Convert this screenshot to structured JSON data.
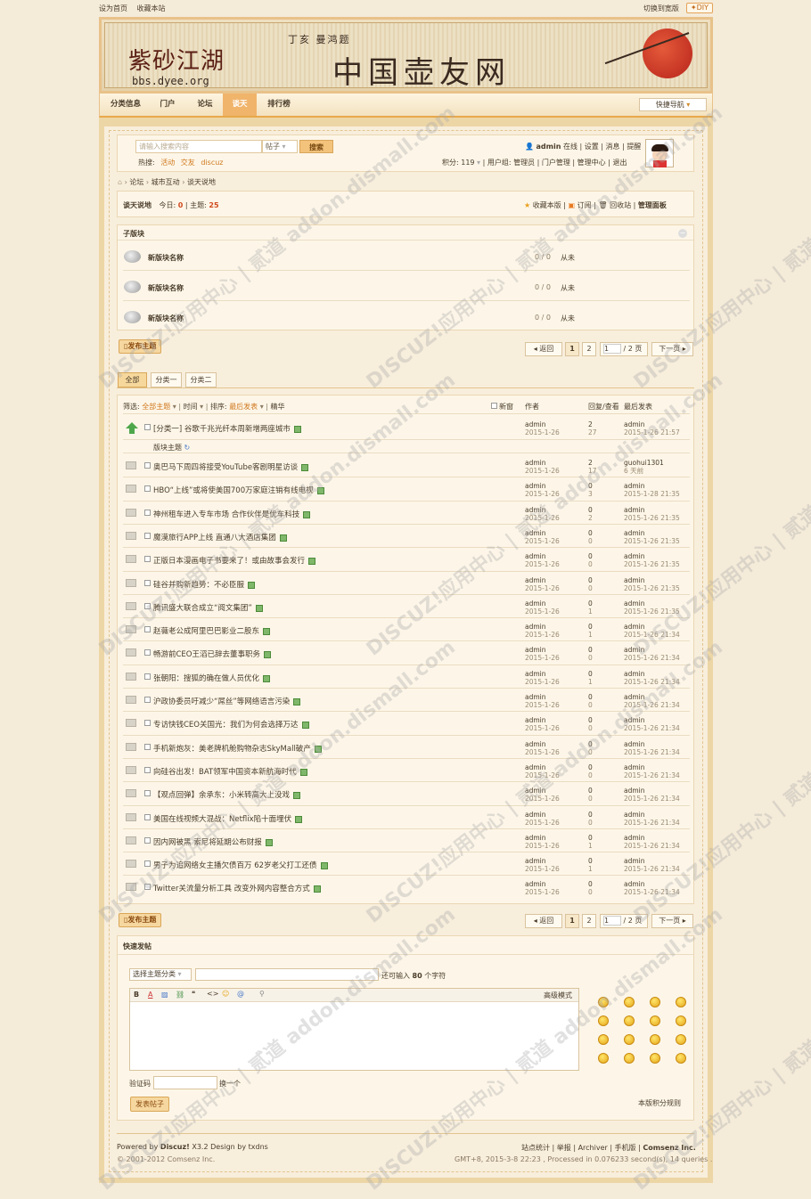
{
  "topbar": {
    "set_home": "设为首页",
    "bookmark": "收藏本站",
    "switch_width": "切换到宽版",
    "diy": "✦DIY"
  },
  "banner": {
    "logo_cn": "紫砂江湖",
    "logo_url": "bbs.dyee.org",
    "site_name": "中国壶友网",
    "slogan": "丁亥 曼鸿题"
  },
  "nav": {
    "items": [
      "分类信息",
      "门户",
      "论坛",
      "谈天",
      "排行榜"
    ],
    "active": "谈天",
    "quick_nav": "快捷导航"
  },
  "search": {
    "placeholder": "请输入搜索内容",
    "type": "帖子",
    "button": "搜索",
    "hot_label": "热搜:",
    "hot": [
      "活动",
      "交友",
      "discuz"
    ]
  },
  "user": {
    "name": "admin",
    "online": "在线",
    "links": [
      "设置",
      "消息",
      "提醒"
    ],
    "points_label": "积分: 119",
    "group_label": "用户组:",
    "group": "管理员",
    "admin_links": [
      "门户管理",
      "管理中心",
      "退出"
    ]
  },
  "breadcrumb": [
    "论坛",
    "城市互动",
    "谈天说地"
  ],
  "forum": {
    "name": "谈天说地",
    "today_label": "今日:",
    "today": "0",
    "topics_label": "主题:",
    "topics": "25",
    "actions": [
      "收藏本版",
      "订阅",
      "回收站",
      "管理面板"
    ]
  },
  "subforums": {
    "title": "子版块",
    "rows": [
      {
        "name": "新版块名称",
        "stats": "0 / 0",
        "last": "从未"
      },
      {
        "name": "新版块名称",
        "stats": "0 / 0",
        "last": "从未"
      },
      {
        "name": "新版块名称",
        "stats": "0 / 0",
        "last": "从未"
      }
    ]
  },
  "pager": {
    "post_button": "发布主题",
    "back": "返回",
    "pages": [
      "1",
      "2"
    ],
    "page_input": "1",
    "total": "/ 2 页",
    "next": "下一页"
  },
  "tabs": [
    "全部",
    "分类一",
    "分类二"
  ],
  "filter": {
    "label": "筛选:",
    "all_topics": "全部主题",
    "time": "时间",
    "sort_label": "排序:",
    "sort": "最后发表",
    "digest": "精华",
    "new_window": "新窗",
    "col_author": "作者",
    "col_replies": "回复/查看",
    "col_last": "最后发表"
  },
  "pinned": {
    "title": "[分类一] 谷歌千兆光纤本周新增两座城市",
    "author": "admin",
    "date": "2015-1-26",
    "replies": "2",
    "views": "27",
    "last_user": "admin",
    "last_time": "2015-1-26 21:57"
  },
  "normal_label": "版块主题",
  "threads": [
    {
      "title": "奥巴马下周四将接受YouTube客剧明星访谈",
      "author": "admin",
      "date": "2015-1-26",
      "replies": "2",
      "views": "17",
      "last_user": "guohui1301",
      "last_time": "6 天前"
    },
    {
      "title": "HBO“上线”或将使美国700万家庭注销有线电视",
      "author": "admin",
      "date": "2015-1-26",
      "replies": "0",
      "views": "3",
      "last_user": "admin",
      "last_time": "2015-1-28 21:35"
    },
    {
      "title": "神州租车进入专车市场 合作伙伴是优车科技",
      "author": "admin",
      "date": "2015-1-26",
      "replies": "0",
      "views": "2",
      "last_user": "admin",
      "last_time": "2015-1-26 21:35"
    },
    {
      "title": "魔漠旅行APP上线 直通八大酒店集团",
      "author": "admin",
      "date": "2015-1-26",
      "replies": "0",
      "views": "0",
      "last_user": "admin",
      "last_time": "2015-1-26 21:35"
    },
    {
      "title": "正版日本漫画电子书要来了！或由故事会发行",
      "author": "admin",
      "date": "2015-1-26",
      "replies": "0",
      "views": "0",
      "last_user": "admin",
      "last_time": "2015-1-26 21:35"
    },
    {
      "title": "硅谷并购新趋势：不必臣服",
      "author": "admin",
      "date": "2015-1-26",
      "replies": "0",
      "views": "0",
      "last_user": "admin",
      "last_time": "2015-1-26 21:35"
    },
    {
      "title": "腾讯盛大联合成立“阅文集团”",
      "author": "admin",
      "date": "2015-1-26",
      "replies": "0",
      "views": "1",
      "last_user": "admin",
      "last_time": "2015-1-26 21:35"
    },
    {
      "title": "赵薇老公成阿里巴巴影业二股东",
      "author": "admin",
      "date": "2015-1-26",
      "replies": "0",
      "views": "1",
      "last_user": "admin",
      "last_time": "2015-1-26 21:34"
    },
    {
      "title": "畅游前CEO王滔已辞去董事职务",
      "author": "admin",
      "date": "2015-1-26",
      "replies": "0",
      "views": "0",
      "last_user": "admin",
      "last_time": "2015-1-26 21:34"
    },
    {
      "title": "张朝阳：搜狐的确在做人员优化",
      "author": "admin",
      "date": "2015-1-26",
      "replies": "0",
      "views": "1",
      "last_user": "admin",
      "last_time": "2015-1-26 21:34"
    },
    {
      "title": "沪政协委员吁减少“屌丝”等网络语言污染",
      "author": "admin",
      "date": "2015-1-26",
      "replies": "0",
      "views": "0",
      "last_user": "admin",
      "last_time": "2015-1-26 21:34"
    },
    {
      "title": "专访快钱CEO关国光：我们为何会选择万达",
      "author": "admin",
      "date": "2015-1-26",
      "replies": "0",
      "views": "0",
      "last_user": "admin",
      "last_time": "2015-1-26 21:34"
    },
    {
      "title": "手机新炮灰：美老牌机舱购物杂志SkyMall破产",
      "author": "admin",
      "date": "2015-1-26",
      "replies": "0",
      "views": "0",
      "last_user": "admin",
      "last_time": "2015-1-26 21:34"
    },
    {
      "title": "向硅谷出发！BAT领军中国资本新航海时代",
      "author": "admin",
      "date": "2015-1-26",
      "replies": "0",
      "views": "0",
      "last_user": "admin",
      "last_time": "2015-1-26 21:34"
    },
    {
      "title": "【观点回弹】余承东：小米转高大上没戏",
      "author": "admin",
      "date": "2015-1-26",
      "replies": "0",
      "views": "0",
      "last_user": "admin",
      "last_time": "2015-1-26 21:34"
    },
    {
      "title": "美国在线视频大混战：Netflix陷十面埋伏",
      "author": "admin",
      "date": "2015-1-26",
      "replies": "0",
      "views": "0",
      "last_user": "admin",
      "last_time": "2015-1-26 21:34"
    },
    {
      "title": "因内网被黑 索尼将延期公布财报",
      "author": "admin",
      "date": "2015-1-26",
      "replies": "0",
      "views": "1",
      "last_user": "admin",
      "last_time": "2015-1-26 21:34"
    },
    {
      "title": "男子为追网络女主播欠债百万 62岁老父打工还债",
      "author": "admin",
      "date": "2015-1-26",
      "replies": "0",
      "views": "1",
      "last_user": "admin",
      "last_time": "2015-1-26 21:34"
    },
    {
      "title": "Twitter关流量分析工具 改变外网内容整合方式",
      "author": "admin",
      "date": "2015-1-26",
      "replies": "0",
      "views": "0",
      "last_user": "admin",
      "last_time": "2015-1-26 21:34"
    }
  ],
  "quickpost": {
    "title": "快速发帖",
    "select_type": "选择主题分类",
    "remain_prefix": "还可输入",
    "remain": "80",
    "remain_suffix": "个字符",
    "advanced": "高级模式",
    "captcha_label": "验证码",
    "captcha_refresh": "换一个",
    "submit": "发表帖子",
    "rules": "本版积分规则"
  },
  "footer": {
    "powered_prefix": "Powered by",
    "powered_brand": "Discuz!",
    "powered_suffix": "X3.2 Design by txdns",
    "copyright": "© 2001-2012 Comsenz Inc.",
    "links": [
      "站点统计",
      "举报",
      "Archiver",
      "手机版"
    ],
    "company": "Comsenz Inc.",
    "runtime": "GMT+8, 2015-3-8 22:23 , Processed in 0.076233 second(s), 14 queries ."
  },
  "watermark": "DISCUZ!应用中心 | 贰道 addon.dismall.com"
}
